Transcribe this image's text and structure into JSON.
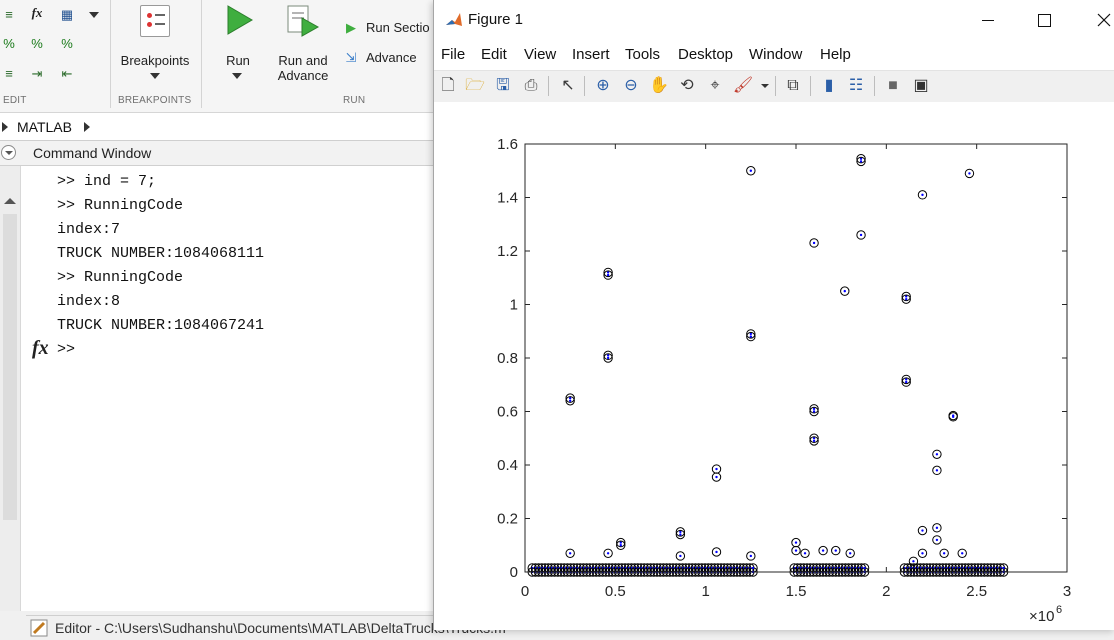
{
  "ribbon": {
    "breakpoints_label": "Breakpoints",
    "run_label": "Run",
    "run_advance_line1": "Run and",
    "run_advance_line2": "Advance",
    "run_section_label": "Run Sectio",
    "advance_label": "Advance",
    "groups": {
      "edit": "EDIT",
      "breakpoints": "BREAKPOINTS",
      "run": "RUN"
    }
  },
  "address": {
    "root": "MATLAB"
  },
  "command_window": {
    "title": "Command Window",
    "lines": [
      ">> ind = 7;",
      ">> RunningCode",
      "index:7",
      "TRUCK NUMBER:1084068111",
      ">> RunningCode",
      "index:8",
      "TRUCK NUMBER:1084067241",
      ">>"
    ],
    "fx_glyph": "fx"
  },
  "editor": {
    "label": "Editor - C:\\Users\\Sudhanshu\\Documents\\MATLAB\\DeltaTrucks\\Trucks.m"
  },
  "figure": {
    "title": "Figure 1",
    "menus": [
      "File",
      "Edit",
      "View",
      "Insert",
      "Tools",
      "Desktop",
      "Window",
      "Help"
    ],
    "toolbar_icons": [
      "new-figure-icon",
      "open-file-icon",
      "save-icon",
      "print-icon",
      "pointer-icon",
      "zoom-in-icon",
      "zoom-out-icon",
      "pan-icon",
      "rotate-icon",
      "data-cursor-icon",
      "brush-icon",
      "link-plot-icon",
      "colorbar-icon",
      "legend-icon",
      "hide-plot-tools-icon",
      "show-plot-tools-icon"
    ]
  },
  "chart_data": {
    "type": "scatter",
    "marker": "circle with dot center",
    "marker_colors": {
      "outer": "#000000",
      "inner": "#0000ff"
    },
    "xlim": [
      0,
      3
    ],
    "ylim": [
      0,
      1.6
    ],
    "x_multiplier": "×10^6",
    "xticks": [
      "0",
      "0.5",
      "1",
      "1.5",
      "2",
      "2.5",
      "3"
    ],
    "yticks": [
      "0",
      "0.2",
      "0.4",
      "0.6",
      "0.8",
      "1",
      "1.2",
      "1.4",
      "1.6"
    ],
    "points_x_millions": [
      0.25,
      0.25,
      0.46,
      0.46,
      0.46,
      0.46,
      1.25,
      1.25,
      1.25,
      1.06,
      1.06,
      0.86,
      0.86,
      1.6,
      1.6,
      1.6,
      1.6,
      1.6,
      1.77,
      1.86,
      1.86,
      1.86,
      2.11,
      2.11,
      2.11,
      2.11,
      2.2,
      2.28,
      2.28,
      2.37,
      2.37,
      2.46,
      0.53,
      0.53,
      2.2,
      2.2,
      2.28,
      2.28,
      1.5,
      1.5,
      1.55,
      1.65,
      1.72,
      1.8,
      0.25,
      0.46,
      0.86,
      1.06,
      1.25,
      2.32,
      2.42,
      2.15
    ],
    "points_y": [
      0.65,
      0.64,
      1.12,
      1.11,
      0.81,
      0.8,
      1.5,
      0.89,
      0.88,
      0.385,
      0.355,
      0.15,
      0.14,
      1.23,
      0.61,
      0.6,
      0.5,
      0.49,
      1.05,
      1.545,
      1.535,
      1.26,
      1.03,
      1.02,
      0.72,
      0.71,
      1.41,
      0.44,
      0.38,
      0.585,
      0.58,
      1.49,
      0.11,
      0.1,
      0.155,
      0.07,
      0.165,
      0.12,
      0.11,
      0.08,
      0.07,
      0.08,
      0.08,
      0.07,
      0.07,
      0.07,
      0.06,
      0.075,
      0.06,
      0.07,
      0.07,
      0.04
    ],
    "dense_band_x_ranges_millions": [
      [
        0.04,
        1.27
      ],
      [
        1.49,
        1.88
      ],
      [
        2.1,
        2.65
      ]
    ],
    "dense_band_y_max": 0.03
  }
}
